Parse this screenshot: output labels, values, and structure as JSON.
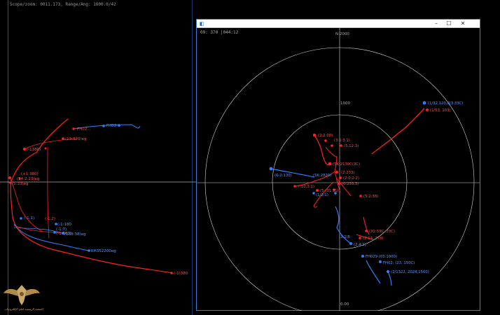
{
  "main": {
    "status_text": "Scope/zoom: 0011.173, Range/Ang: 1600.0/42",
    "colors": {
      "red_track": "#ff2020",
      "blue_track": "#2f7fff",
      "grid": "#ffffff",
      "background": "#000000"
    },
    "tracks": [
      {
        "label": "FH02...",
        "color": "red"
      },
      {
        "label": "FH03...",
        "color": "blue"
      },
      {
        "label": "(13:320)eg",
        "color": "red"
      },
      {
        "label": "(-1380)",
        "color": "red"
      },
      {
        "label": "(+1:380)",
        "color": "red"
      },
      {
        "label": "(34:2:23)eg",
        "color": "red"
      },
      {
        "label": "(5:33)eg",
        "color": "red"
      },
      {
        "label": "(-1:1)",
        "color": "blue"
      },
      {
        "label": "(-1,2)",
        "color": "red"
      },
      {
        "label": "(-1:180",
        "color": "blue"
      },
      {
        "label": "(-1:7)",
        "color": "blue"
      },
      {
        "label": "(-1:160)",
        "color": "blue"
      },
      {
        "label": "(133:38)eg",
        "color": "blue"
      },
      {
        "label": "KH352200eg",
        "color": "blue"
      },
      {
        "label": "(-1)380",
        "color": "red"
      }
    ]
  },
  "radar_window": {
    "title_icon": "radar-app-icon",
    "controls": {
      "minimize": "–",
      "maximize": "☐",
      "close": "✕"
    },
    "readout": "09: 370 |044:12",
    "ring_labels": {
      "north": "N 2000",
      "inner_top": "1000",
      "south": "0.00"
    },
    "tracks": [
      {
        "label": "(1/32,120,8(3,33C)",
        "color": "blue"
      },
      {
        "label": "(1/53, 103)",
        "color": "red"
      },
      {
        "label": "(2:2:00)",
        "color": "red"
      },
      {
        "label": "(3:1:3.1)",
        "color": "red"
      },
      {
        "label": "(5:12:3)",
        "color": "red"
      },
      {
        "label": "(5K:2130C(3C)",
        "color": "red"
      },
      {
        "label": "(-10,3:1)",
        "color": "red"
      },
      {
        "label": "(6-2:130)",
        "color": "blue"
      },
      {
        "label": "(5K:2820)",
        "color": "blue"
      },
      {
        "label": "(2:233)",
        "color": "red"
      },
      {
        "label": "(2:0:2:2)",
        "color": "red"
      },
      {
        "label": "(0:233,3)",
        "color": "red"
      },
      {
        "label": "(5:(31:31)",
        "color": "red"
      },
      {
        "label": "(1/2/1)",
        "color": "blue"
      },
      {
        "label": "(5:2:38)",
        "color": "red"
      },
      {
        "label": "(31:33C, 33C)",
        "color": "red"
      },
      {
        "label": "(2:13, 278)",
        "color": "red"
      },
      {
        "label": "(3:1)5",
        "color": "blue"
      },
      {
        "label": "(2:4:1)",
        "color": "blue"
      },
      {
        "label": "FH029 (03:1000)",
        "color": "blue"
      },
      {
        "label": "FH02: (23, 150C)",
        "color": "blue"
      },
      {
        "label": "(2/1322, 2024,1500)",
        "color": "blue"
      }
    ]
  },
  "logo": {
    "text": "المنصة الرسمية لعلم الإلكترونيات"
  }
}
